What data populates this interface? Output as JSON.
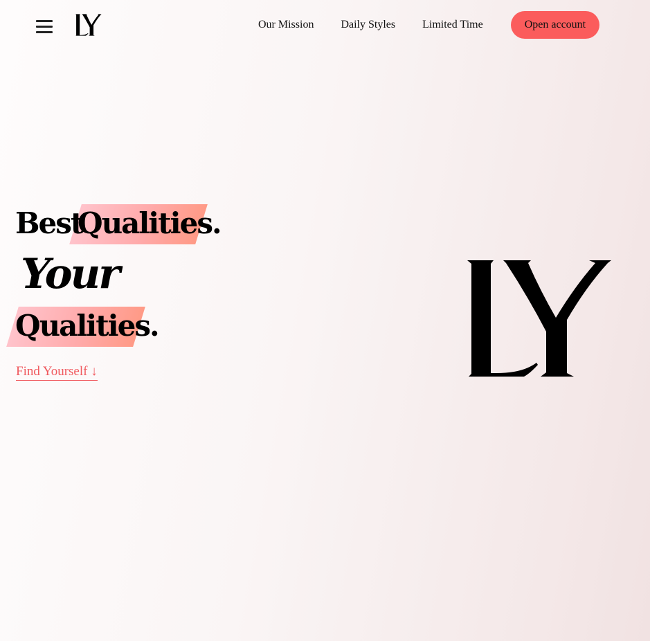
{
  "brand": {
    "logo_text": "LY"
  },
  "nav": {
    "items": [
      {
        "label": "Our Mission"
      },
      {
        "label": "Daily Styles"
      },
      {
        "label": "Limited Time"
      }
    ],
    "cta_label": "Open account"
  },
  "hero": {
    "line1_word1": "Best",
    "line1_word2": "Qualities.",
    "line2": "Your",
    "line3": "Qualities.",
    "link_label": "Find Yourself ↓"
  },
  "colors": {
    "accent": "#fb5c5c",
    "link": "#f0595e",
    "highlight_start": "#ffc3cb",
    "highlight_end": "#ff9a86"
  },
  "icons": {
    "menu": "hamburger-menu-icon",
    "logo": "ly-monogram-logo"
  }
}
